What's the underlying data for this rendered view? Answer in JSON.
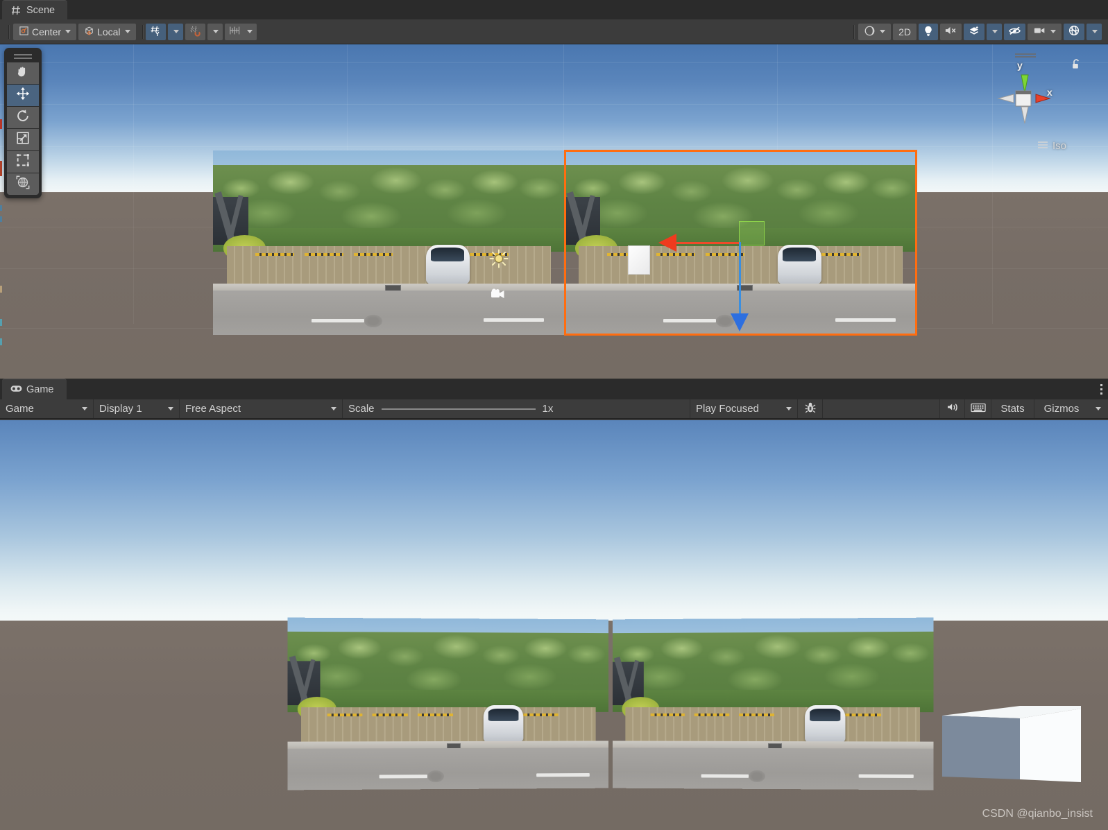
{
  "scene": {
    "tab_label": "Scene",
    "tab_icon": "grid-hash-icon",
    "toolbar": {
      "pivot_label": "Center",
      "pivot_icon": "pivot-center-icon",
      "handle_label": "Local",
      "handle_icon": "handle-local-icon",
      "grid_icon": "grid-axis-y-icon",
      "grid_dropdown_icon": "chevron-down-icon",
      "snap_icon": "grid-snap-magnet-icon",
      "snap_dropdown_icon": "chevron-down-icon",
      "increment_icon": "increment-snap-icon",
      "increment_dropdown_icon": "chevron-down-icon",
      "shading_icon": "shaded-sphere-icon",
      "shading_dropdown_icon": "chevron-down-icon",
      "twod_label": "2D",
      "light_icon": "lightbulb-icon",
      "audio_icon": "audio-muted-icon",
      "fx_icon": "effects-layers-icon",
      "fx_dropdown_icon": "chevron-down-icon",
      "hidden_icon": "eye-slash-icon",
      "camera_icon": "scene-camera-icon",
      "camera_dropdown_icon": "chevron-down-icon",
      "gizmos_icon": "gizmos-globe-icon",
      "gizmos_dropdown_icon": "chevron-down-icon"
    },
    "tools": [
      {
        "name": "hand-tool",
        "icon": "hand-icon",
        "active": false
      },
      {
        "name": "move-tool",
        "icon": "move-arrows-icon",
        "active": true
      },
      {
        "name": "rotate-tool",
        "icon": "rotate-icon",
        "active": false
      },
      {
        "name": "scale-tool",
        "icon": "scale-icon",
        "active": false
      },
      {
        "name": "rect-tool",
        "icon": "rect-transform-icon",
        "active": false
      },
      {
        "name": "transform-tool",
        "icon": "transform-globe-icon",
        "active": false
      }
    ],
    "orientation_gizmo": {
      "axis_x_label": "x",
      "axis_y_label": "y",
      "projection_label": "Iso",
      "lock_icon": "unlock-icon",
      "axis_x_color": "#e8402a",
      "axis_y_color": "#7dd634"
    },
    "gizmo_labels": {
      "light_gizmo": "directional-light-gizmo",
      "camera_gizmo": "camera-gizmo"
    },
    "selection": {
      "outline_color": "#ff6d10",
      "move_x_axis_color": "#ef3b1e",
      "move_y_axis_color": "#2d6fe0",
      "move_plane_color": "#8fd64a"
    }
  },
  "game": {
    "tab_label": "Game",
    "tab_icon": "gamepad-icon",
    "toolbar": {
      "view_label": "Game",
      "display_label": "Display 1",
      "aspect_label": "Free Aspect",
      "scale_label": "Scale",
      "scale_value": "1x",
      "play_mode_label": "Play Focused",
      "debug_icon": "bug-icon",
      "mute_icon": "mute-audio-icon",
      "stats_icon": "frame-debugger-icon",
      "stats_label": "Stats",
      "gizmos_label": "Gizmos",
      "gizmos_dropdown_icon": "chevron-down-icon",
      "kebab_icon": "more-options-icon"
    }
  },
  "watermark": "CSDN @qianbo_insist"
}
